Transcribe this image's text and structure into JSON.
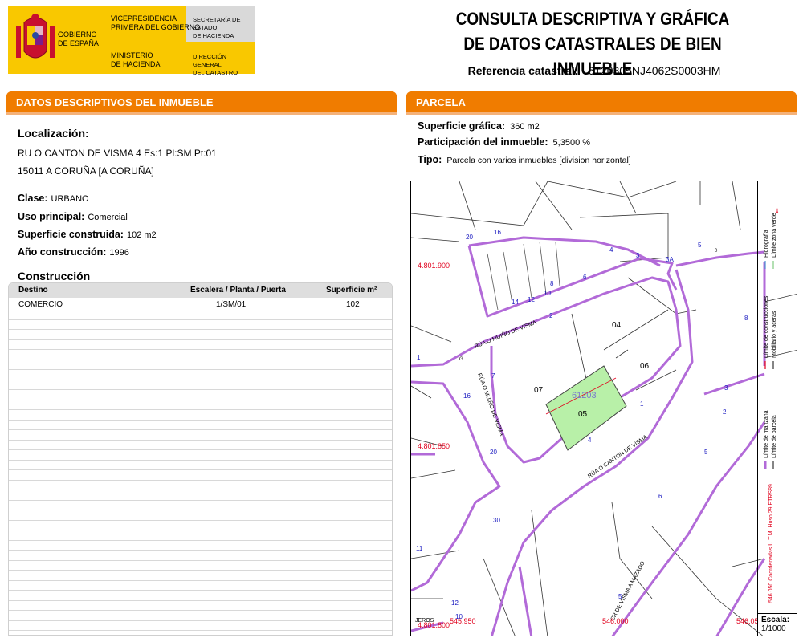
{
  "header": {
    "gobierno": [
      "GOBIERNO",
      "DE ESPAÑA"
    ],
    "vicepresidencia": [
      "VICEPRESIDENCIA",
      "PRIMERA DEL GOBIERNO"
    ],
    "ministerio": [
      "MINISTERIO",
      "DE HACIENDA"
    ],
    "secretaria": [
      "SECRETARÍA DE ESTADO",
      "DE HACIENDA"
    ],
    "direccion": [
      "DIRECCIÓN GENERAL",
      "DEL CATASTRO"
    ],
    "title_line1": "CONSULTA DESCRIPTIVA Y GRÁFICA",
    "title_line2": "DE DATOS CATASTRALES DE BIEN INMUEBLE",
    "ref_label": "Referencia catastral:",
    "ref_value": "6120305NJ4062S0003HM"
  },
  "left": {
    "section_title": "DATOS DESCRIPTIVOS DEL INMUEBLE",
    "loc_title": "Localización:",
    "loc_line1": "RU O CANTON DE VISMA 4 Es:1 Pl:SM Pt:01",
    "loc_line2": "15011 A CORUÑA [A CORUÑA]",
    "clase_label": "Clase:",
    "clase_value": "URBANO",
    "uso_label": "Uso principal:",
    "uso_value": "Comercial",
    "sup_label": "Superficie construida:",
    "sup_value": "102 m2",
    "anio_label": "Año construcción:",
    "anio_value": "1996",
    "cons_title": "Construcción",
    "table_headers": [
      "Destino",
      "Escalera / Planta / Puerta",
      "Superficie m²"
    ],
    "table_rows": [
      [
        "COMERCIO",
        "1/SM/01",
        "102"
      ]
    ]
  },
  "right": {
    "section_title": "PARCELA",
    "supg_label": "Superficie gráfica:",
    "supg_value": "360 m2",
    "part_label": "Participación del inmueble:",
    "part_value": "5,3500 %",
    "tipo_label": "Tipo:",
    "tipo_value": "Parcela con varios inmuebles [division horizontal]"
  },
  "map": {
    "parcel_ref": "61203",
    "lots": [
      "04",
      "06",
      "07",
      "05"
    ],
    "coord_labels_y": [
      "4.801.900",
      "4.801.850",
      "4.801.800"
    ],
    "coord_labels_x": [
      "545.950",
      "546.000",
      "546.05"
    ],
    "street_labels": [
      "RÚA O MUIÑO DE VISMA",
      "RÚA O MUIÑO DE VISMA",
      "RÚA O CANTON DE VISMA",
      "CR DE VISMA A MAZADO"
    ],
    "house_numbers": [
      "20",
      "16",
      "14",
      "12",
      "10",
      "8",
      "6",
      "4",
      "3",
      "3A",
      "5",
      "2",
      "1",
      "3",
      "2",
      "4",
      "5",
      "6",
      "7",
      "8",
      "1",
      "16",
      "20",
      "30",
      "5",
      "10",
      "12",
      "11"
    ],
    "misc_labels": [
      "G",
      "0",
      "JEROS"
    ],
    "legend_items": [
      "Límite de manzana",
      "Límite de parcela",
      "Límite de construcciones",
      "Mobiliario y aceras",
      "Límite zona verde",
      "Hidrografía"
    ],
    "projection": "546.050 Coordenadas U.T.M. Huso 29 ETRS89",
    "scale_label": "Escala:",
    "scale_value": "1/1000",
    "colors": {
      "block": "#b26ad8",
      "parcel": "#b8f0a8",
      "coords": "#e0001c",
      "numbers": "#1a1ac0"
    }
  }
}
